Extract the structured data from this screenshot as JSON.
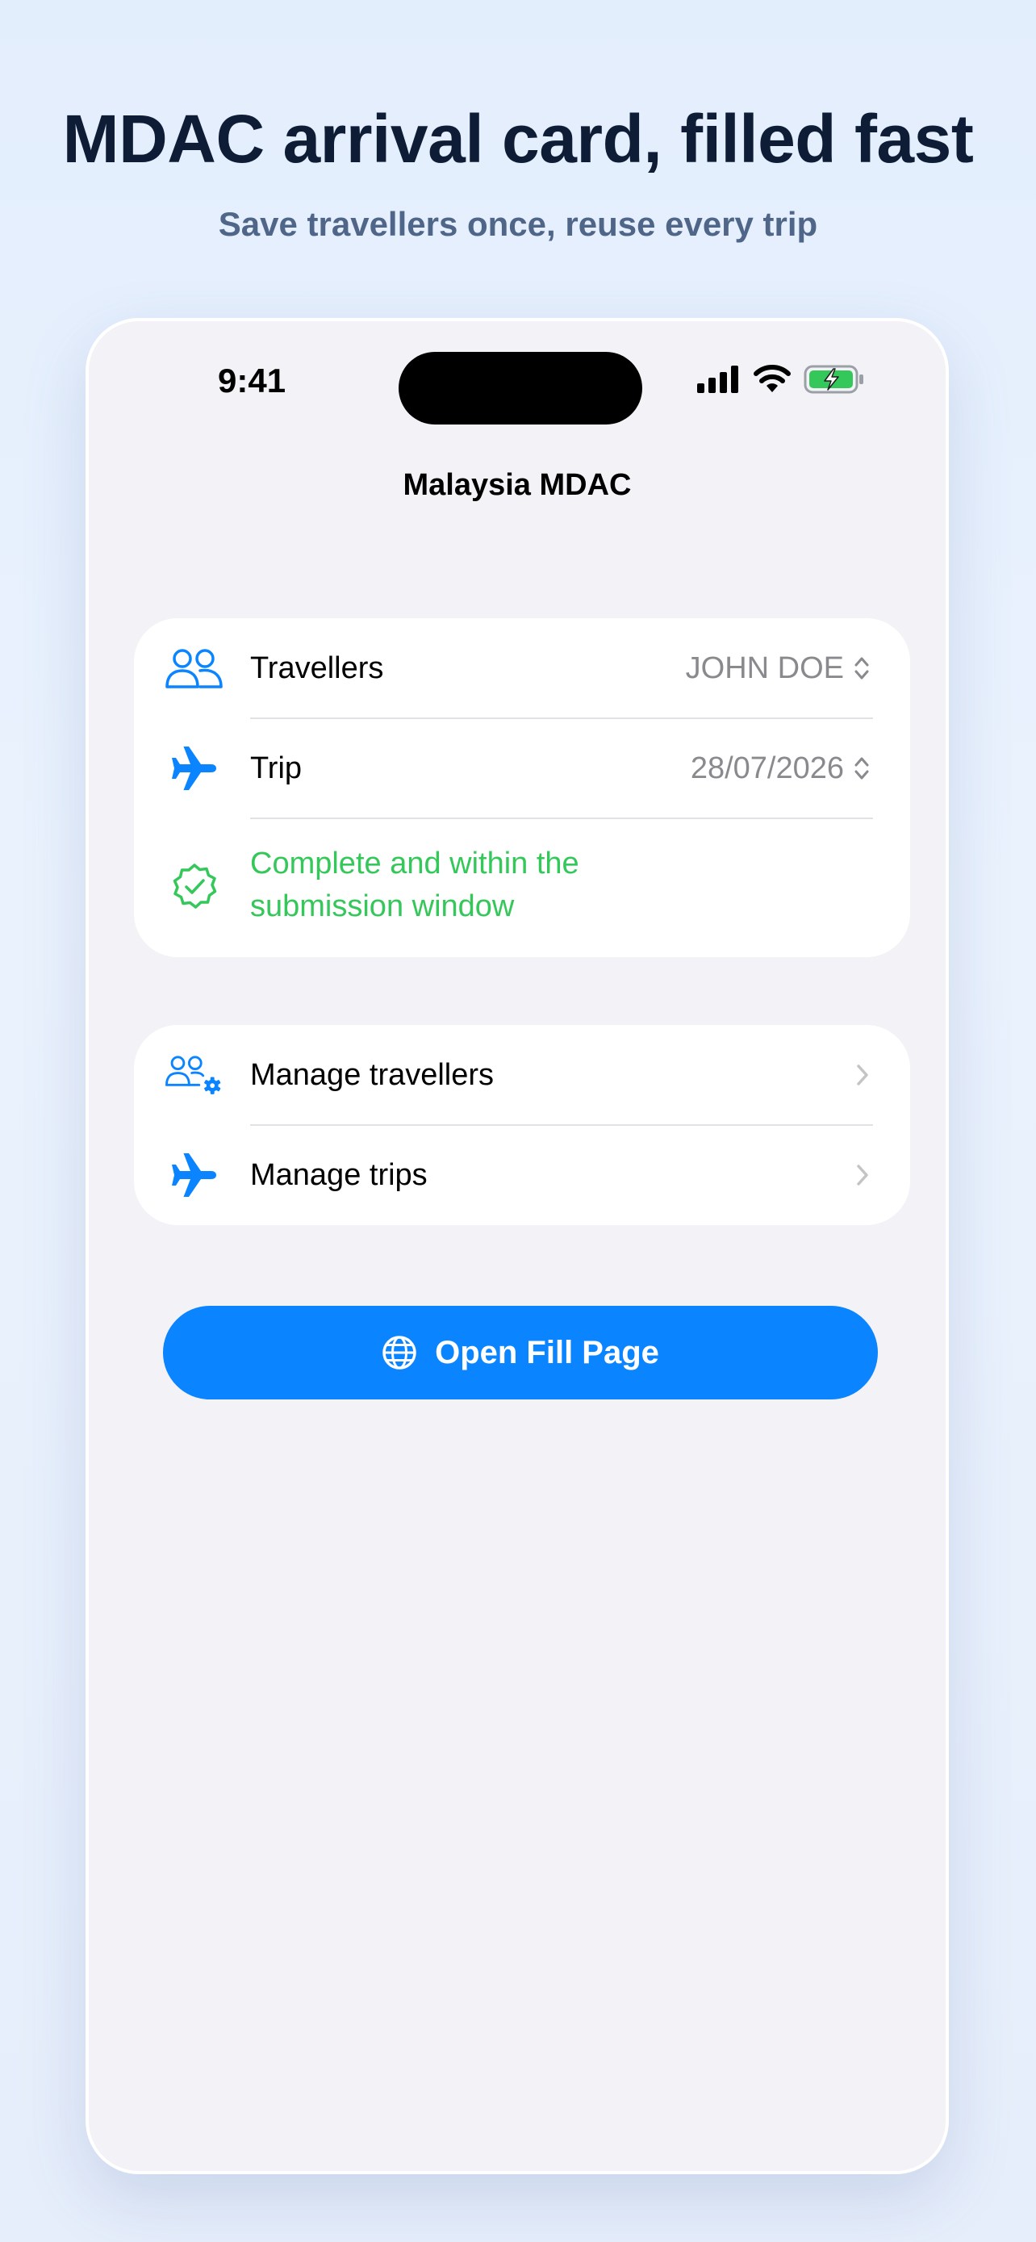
{
  "marketing": {
    "headline": "MDAC arrival card, filled fast",
    "subheadline": "Save travellers once, reuse every trip"
  },
  "status_bar": {
    "time": "9:41"
  },
  "nav": {
    "title": "Malaysia MDAC"
  },
  "selection_card": {
    "travellers": {
      "label": "Travellers",
      "value": "JOHN DOE",
      "icon": "people-icon"
    },
    "trip": {
      "label": "Trip",
      "value": "28/07/2026",
      "icon": "airplane-icon"
    },
    "status": {
      "text": "Complete and within the submission window",
      "icon": "checkmark-seal-icon"
    }
  },
  "manage_card": {
    "items": [
      {
        "label": "Manage travellers",
        "icon": "people-gear-icon"
      },
      {
        "label": "Manage trips",
        "icon": "airplane-icon"
      }
    ]
  },
  "cta": {
    "label": "Open Fill Page",
    "icon": "globe-icon"
  },
  "colors": {
    "accent": "#0a84ff",
    "success": "#34c759",
    "background": "#f2f2f7",
    "headline": "#0e1c36",
    "subheadline": "#4f6688"
  }
}
